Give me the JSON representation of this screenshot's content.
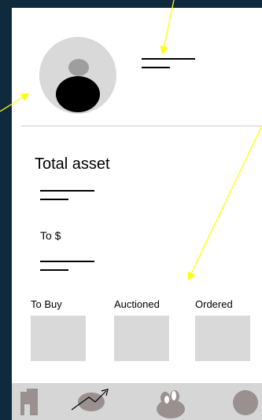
{
  "profile": {
    "avatar_icon": "user-avatar-icon"
  },
  "asset": {
    "title": "Total asset",
    "to_label": "To $"
  },
  "columns": [
    {
      "label": "To Buy"
    },
    {
      "label": "Auctioned"
    },
    {
      "label": "Ordered"
    }
  ],
  "nav": {
    "items": [
      {
        "icon": "building-icon"
      },
      {
        "icon": "trend-chart-icon"
      },
      {
        "icon": "group-icon"
      },
      {
        "icon": "profile-icon"
      }
    ]
  },
  "colors": {
    "background": "#0f2a3c",
    "annotation_arrow": "#ffff00",
    "placeholder_gray": "#d9d9d9"
  }
}
